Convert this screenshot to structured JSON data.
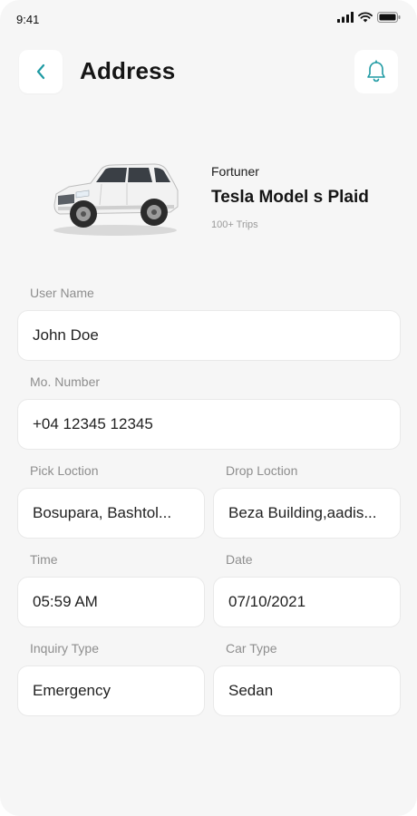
{
  "status_bar": {
    "time": "9:41"
  },
  "header": {
    "title": "Address",
    "back_icon": "chevron-left-icon",
    "bell_icon": "bell-icon"
  },
  "car": {
    "brand": "Fortuner",
    "model": "Tesla Model s Plaid",
    "trips": "100+ Trips"
  },
  "form": {
    "user_name": {
      "label": "User Name",
      "value": "John Doe"
    },
    "mobile": {
      "label": "Mo. Number",
      "value": "+04 12345 12345"
    },
    "pick_location": {
      "label": "Pick Loction",
      "value": "Bosupara, Bashtol..."
    },
    "drop_location": {
      "label": "Drop Loction",
      "value": "Beza Building,aadis..."
    },
    "time": {
      "label": "Time",
      "value": "05:59 AM"
    },
    "date": {
      "label": "Date",
      "value": "07/10/2021"
    },
    "inquiry_type": {
      "label": "Inquiry Type",
      "value": "Emergency"
    },
    "car_type": {
      "label": "Car Type",
      "value": "Sedan"
    }
  },
  "colors": {
    "accent": "#1f9aa3",
    "background": "#f6f6f6",
    "card": "#ffffff",
    "label": "#8e8e8e"
  }
}
